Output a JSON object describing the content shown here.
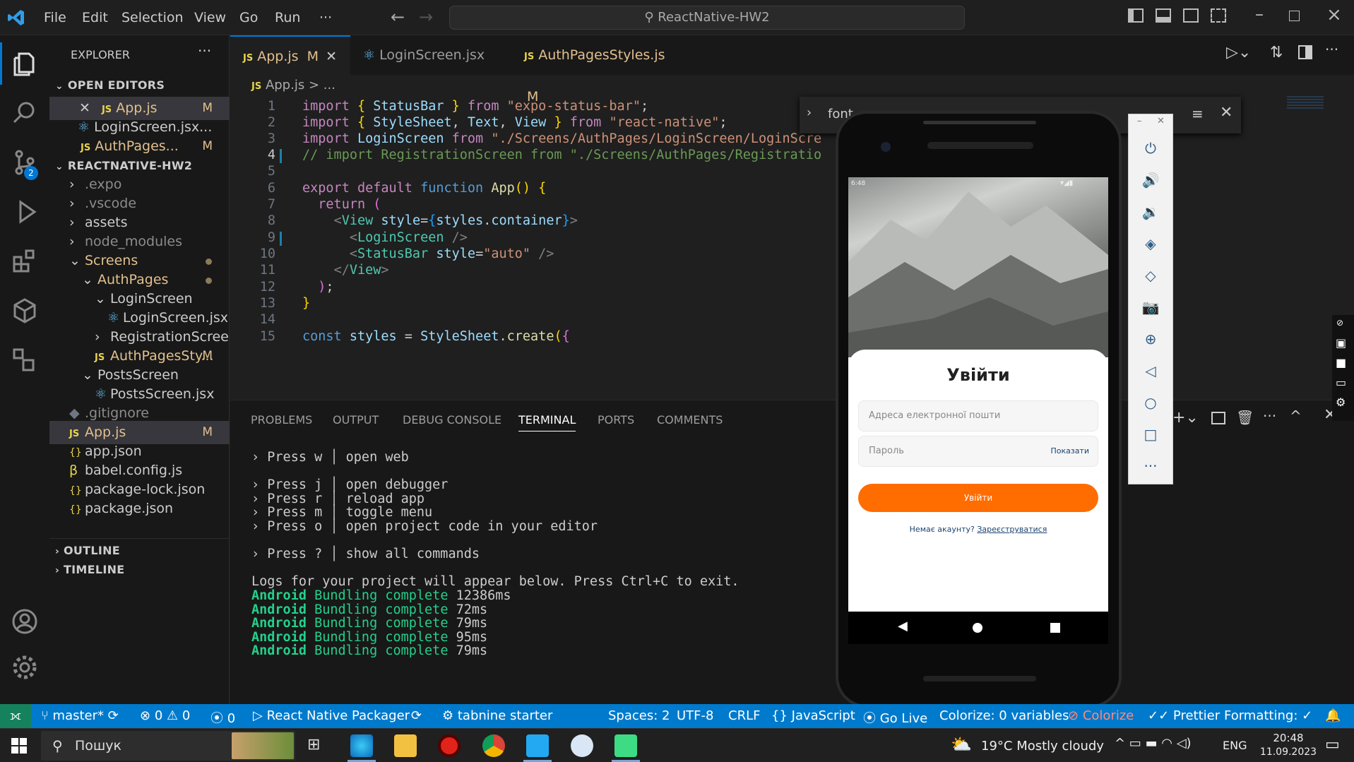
{
  "titlebar": {
    "menus": [
      "File",
      "Edit",
      "Selection",
      "View",
      "Go",
      "Run",
      "···"
    ],
    "search": "ReactNative-HW2"
  },
  "activity": {
    "scm_badge": "2"
  },
  "sidebar": {
    "explorer_title": "EXPLORER",
    "open_editors_title": "OPEN EDITORS",
    "open_editors": [
      {
        "name": "App.js",
        "badge": "M",
        "icon": "js-icon"
      },
      {
        "name": "LoginScreen.jsx...",
        "badge": "",
        "icon": "react-icon"
      },
      {
        "name": "AuthPages...",
        "badge": "M",
        "icon": "js-icon"
      }
    ],
    "project_title": "REACTNATIVE-HW2",
    "tree": [
      {
        "name": ".expo",
        "kind": "folder"
      },
      {
        "name": ".vscode",
        "kind": "folder"
      },
      {
        "name": "assets",
        "kind": "folder"
      },
      {
        "name": "node_modules",
        "kind": "folder"
      },
      {
        "name": "Screens",
        "kind": "open"
      },
      {
        "name": "AuthPages",
        "kind": "open"
      },
      {
        "name": "LoginScreen",
        "kind": "open"
      },
      {
        "name": "LoginScreen.jsx",
        "kind": "react"
      },
      {
        "name": "RegistrationScreen",
        "kind": "folder"
      },
      {
        "name": "AuthPagesSty...",
        "kind": "js",
        "badge": "M"
      },
      {
        "name": "PostsScreen",
        "kind": "open"
      },
      {
        "name": "PostsScreen.jsx",
        "kind": "react"
      },
      {
        "name": ".gitignore",
        "kind": "git"
      },
      {
        "name": "App.js",
        "kind": "js",
        "badge": "M"
      },
      {
        "name": "app.json",
        "kind": "json"
      },
      {
        "name": "babel.config.js",
        "kind": "babel"
      },
      {
        "name": "package-lock.json",
        "kind": "json"
      },
      {
        "name": "package.json",
        "kind": "json"
      }
    ],
    "outline_title": "OUTLINE",
    "timeline_title": "TIMELINE"
  },
  "tabs": [
    {
      "label": "App.js",
      "badge": "M",
      "icon": "js-icon"
    },
    {
      "label": "LoginScreen.jsx",
      "badge": "",
      "icon": "react-icon"
    },
    {
      "label": "AuthPagesStyles.js",
      "badge": "M",
      "icon": "js-icon"
    }
  ],
  "breadcrumb": {
    "file": "App.js",
    "rest": "> ..."
  },
  "find": {
    "value": "font"
  },
  "code": {
    "line_numbers": [
      "1",
      "2",
      "3",
      "4",
      "5",
      "6",
      "7",
      "8",
      "9",
      "10",
      "11",
      "12",
      "13",
      "14",
      "15"
    ]
  },
  "panel": {
    "tabs": [
      "PROBLEMS",
      "OUTPUT",
      "DEBUG CONSOLE",
      "TERMINAL",
      "PORTS",
      "COMMENTS"
    ]
  },
  "terminal": {
    "lines": [
      "› Press w │ open web",
      "",
      "› Press j │ open debugger",
      "› Press r │ reload app",
      "› Press m │ toggle menu",
      "› Press o │ open project code in your editor",
      "",
      "› Press ? │ show all commands",
      "",
      "Logs for your project will appear below. Press Ctrl+C to exit."
    ],
    "bundles": [
      {
        "label": "Android",
        "status": "Bundling complete",
        "time": "12386ms"
      },
      {
        "label": "Android",
        "status": "Bundling complete",
        "time": "72ms"
      },
      {
        "label": "Android",
        "status": "Bundling complete",
        "time": "79ms"
      },
      {
        "label": "Android",
        "status": "Bundling complete",
        "time": "95ms"
      },
      {
        "label": "Android",
        "status": "Bundling complete",
        "time": "79ms"
      }
    ]
  },
  "phone": {
    "status_time": "6:48",
    "title": "Увійти",
    "email_placeholder": "Адреса електронної пошти",
    "password_placeholder": "Пароль",
    "show_label": "Показати",
    "login_button": "Увійти",
    "no_account": "Немає акаунту?",
    "register_link": "Зареєструватися"
  },
  "statusbar": {
    "branch": "master*",
    "errors": "0",
    "warnings": "0",
    "ports": "0",
    "packager": "React Native Packager",
    "tabnine": "tabnine starter",
    "spaces": "Spaces: 2",
    "encoding": "UTF-8",
    "eol": "CRLF",
    "language": "JavaScript",
    "golive": "Go Live",
    "colorize": "Colorize: 0 variables",
    "colorize2": "Colorize",
    "prettier": "Prettier",
    "formatting": "Formatting: ✓"
  },
  "taskbar": {
    "search": "Пошук",
    "weather": "19°C  Mostly cloudy",
    "lang": "ENG",
    "time": "20:48",
    "date": "11.09.2023"
  },
  "colors": {
    "accent": "#0078d4",
    "status": "#007acc",
    "orange": "#ff6c00"
  }
}
